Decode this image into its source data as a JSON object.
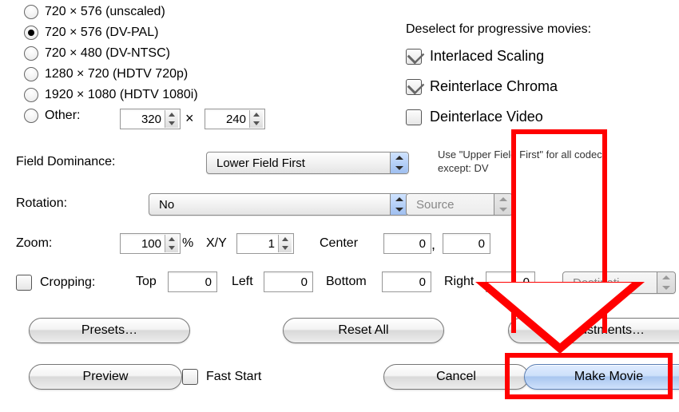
{
  "resolutions": [
    {
      "label": "720 × 576  (unscaled)",
      "selected": false
    },
    {
      "label": "720 × 576  (DV-PAL)",
      "selected": true
    },
    {
      "label": "720 × 480  (DV-NTSC)",
      "selected": false
    },
    {
      "label": "1280 × 720  (HDTV 720p)",
      "selected": false
    },
    {
      "label": "1920 × 1080  (HDTV 1080i)",
      "selected": false
    }
  ],
  "other": {
    "label": "Other:",
    "selected": false,
    "width": "320",
    "height": "240",
    "times": "×"
  },
  "progressive": {
    "heading": "Deselect for progressive movies:",
    "interlaced_scaling": {
      "label": "Interlaced Scaling",
      "on": true
    },
    "reinterlace_chroma": {
      "label": "Reinterlace Chroma",
      "on": true
    },
    "deinterlace_video": {
      "label": "Deinterlace Video",
      "on": false
    }
  },
  "field_dominance": {
    "label": "Field Dominance:",
    "value": "Lower Field First",
    "hint": "Use \"Upper Field First\" for all codecs except: DV"
  },
  "rotation": {
    "label": "Rotation:",
    "value": "No",
    "source_value": "Source"
  },
  "zoom": {
    "label": "Zoom:",
    "value": "100",
    "pct": "%",
    "xy_label": "X/Y",
    "xy_value": "1",
    "center_label": "Center",
    "cx": "0",
    "cy": "0",
    "sep": ","
  },
  "cropping": {
    "label": "Cropping:",
    "on": false,
    "top_label": "Top",
    "top": "0",
    "left_label": "Left",
    "left": "0",
    "bottom_label": "Bottom",
    "bottom": "0",
    "right_label": "Right",
    "right": "0",
    "dest_value": "Destinati..."
  },
  "buttons": {
    "presets": "Presets…",
    "reset_all": "Reset All",
    "adjustments": "Adjustments…",
    "preview": "Preview",
    "fast_start": "Fast Start",
    "cancel": "Cancel",
    "make_movie": "Make Movie"
  }
}
